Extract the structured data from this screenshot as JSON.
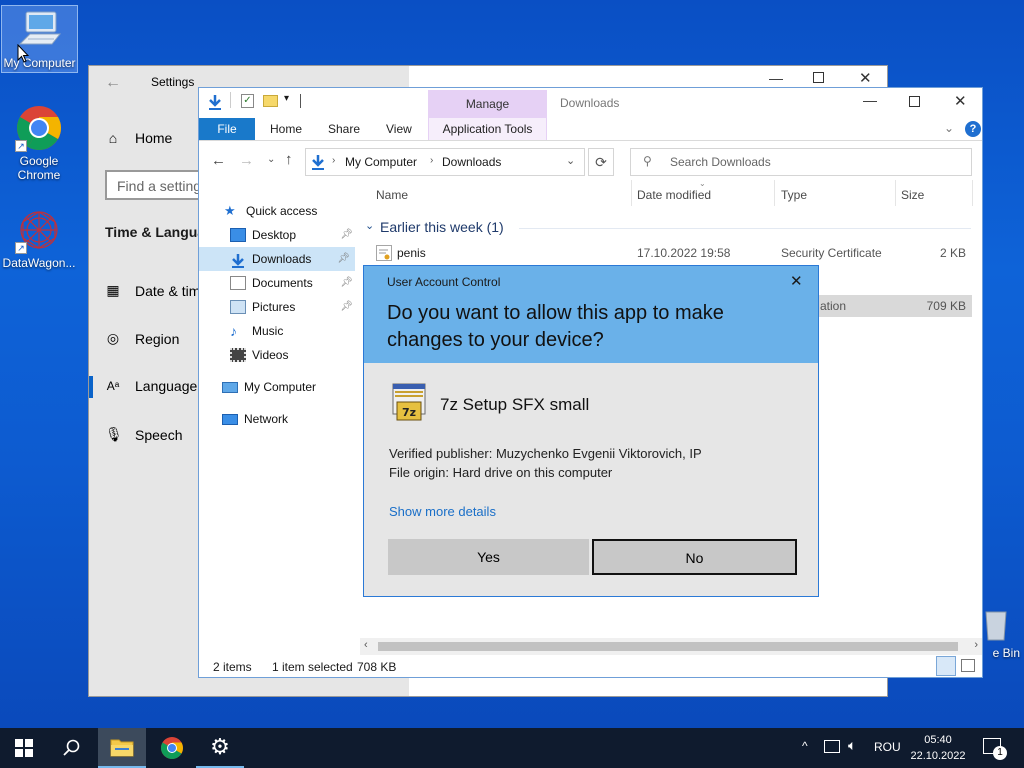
{
  "desktop": {
    "icons": [
      {
        "label": "My Computer"
      },
      {
        "label": "Google Chrome"
      },
      {
        "label": "DataWagon..."
      },
      {
        "label": "e Bin"
      }
    ]
  },
  "settings": {
    "title": "Settings",
    "home": "Home",
    "search_placeholder": "Find a setting",
    "section": "Time & Language",
    "items": [
      "Date & time",
      "Region",
      "Language",
      "Speech"
    ]
  },
  "explorer": {
    "title": "Downloads",
    "manage": "Manage",
    "tabs": [
      "File",
      "Home",
      "Share",
      "View",
      "Application Tools"
    ],
    "breadcrumb": [
      "My Computer",
      "Downloads"
    ],
    "search_placeholder": "Search Downloads",
    "nav": {
      "quick_access": "Quick access",
      "items": [
        "Desktop",
        "Downloads",
        "Documents",
        "Pictures",
        "Music",
        "Videos"
      ],
      "my_computer": "My Computer",
      "network": "Network"
    },
    "columns": [
      "Name",
      "Date modified",
      "Type",
      "Size"
    ],
    "group": "Earlier this week (1)",
    "files": [
      {
        "name": "penis",
        "date": "17.10.2022 19:58",
        "type": "Security Certificate",
        "size": "2 KB"
      },
      {
        "type": "ation",
        "size": "709 KB"
      }
    ],
    "status": {
      "items": "2 items",
      "selected": "1 item selected",
      "size": "708 KB"
    }
  },
  "uac": {
    "title": "User Account Control",
    "question": "Do you want to allow this app to make changes to your device?",
    "app_name": "7z Setup SFX small",
    "publisher": "Verified publisher: Muzychenko Evgenii Viktorovich, IP",
    "origin": "File origin: Hard drive on this computer",
    "details_link": "Show more details",
    "yes": "Yes",
    "no": "No"
  },
  "taskbar": {
    "language": "ROU",
    "time": "05:40",
    "date": "22.10.2022",
    "notification_count": "1"
  },
  "colors": {
    "uac_header": "#6ab1e9",
    "explorer_file_tab": "#1979ca",
    "manage_tab": "#e6d1f5",
    "taskbar": "#0f1b2e"
  }
}
